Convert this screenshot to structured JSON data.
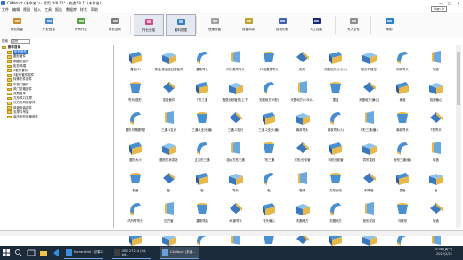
{
  "window": {
    "title": "CAMduct (未命名1) - 套用 \"V8.11\" - 构造 \"8.1\" (未命名)",
    "buttons": [
      "—",
      "□",
      "✕"
    ]
  },
  "menu": [
    "文件",
    "编辑",
    "视图",
    "插入",
    "工具",
    "报告",
    "数据库",
    "样式",
    "帮助"
  ],
  "signin": "Sign In",
  "ribbon": [
    {
      "label": "作业批量",
      "icon": "job-batch-icon",
      "color": "#c98a2a"
    },
    {
      "label": "作业信息",
      "icon": "job-info-icon",
      "color": "#4a8ad0"
    },
    {
      "label": "所有作业",
      "icon": "all-jobs-icon",
      "color": "#5ba04a"
    },
    {
      "label": "作业选项",
      "icon": "job-options-icon",
      "color": "#7a7a7a"
    },
    {
      "label": "作业分组",
      "icon": "job-group-icon",
      "color": "#d04a8a"
    },
    {
      "label": "套料视图",
      "icon": "nesting-view-icon",
      "color": "#3a7ac0"
    },
    {
      "label": "快速设置",
      "icon": "quick-setup-icon",
      "color": "#a0a0a0"
    },
    {
      "label": "设置向导",
      "icon": "setup-wizard-icon",
      "color": "#c0a030"
    },
    {
      "label": "自动切割",
      "icon": "auto-cut-icon",
      "color": "#4060b0"
    },
    {
      "label": "人工加载",
      "icon": "manual-load-icon",
      "color": "#1a2a7a"
    },
    {
      "label": "写入文件",
      "icon": "write-file-icon",
      "color": "#909090"
    },
    {
      "label": "帮助",
      "icon": "help-icon",
      "color": "#3080d0"
    }
  ],
  "filter": {
    "label": "搜索",
    "value": "直线"
  },
  "tree": [
    {
      "label": "部件目录",
      "root": true
    },
    {
      "label": "矩形管件",
      "selected": true
    },
    {
      "label": "圆形管件"
    },
    {
      "label": "椭圆形管件"
    },
    {
      "label": "矩形风帽"
    },
    {
      "label": "2板形管件"
    },
    {
      "label": "3板形管件部件"
    },
    {
      "label": "特殊形件部件"
    },
    {
      "label": "宁夏门管件"
    },
    {
      "label": "风门防烟部件"
    },
    {
      "label": "双层管件"
    },
    {
      "label": "方形风口支撑"
    },
    {
      "label": "长方形风管部件"
    },
    {
      "label": "风管安装部件"
    },
    {
      "label": "支撑与吊架"
    },
    {
      "label": "高压矩形风管部件"
    }
  ],
  "parts": [
    "直管(1)",
    "变径/变截面过渡管件",
    "直角弯头",
    "内外弧弯弯头",
    "45度直角弯头",
    "矩形",
    "天圆地方/小头(L)",
    "矩形内锥形",
    "斜向弯头",
    "铸造",
    "弯头(弧形)",
    "变径管件",
    "T形三通",
    "圆弧分歧管件(上下)",
    "天圆地方(V型)",
    "天圆地方/小头(L)",
    "罩盖",
    "天圆地方(偏心)",
    "铸造",
    "双面偏心",
    "圆形与椭圆T型",
    "三通-1支分",
    "三通-1支分(偏)",
    "三通-2支分",
    "三通-2支分(偏)",
    "裤衩弯头",
    "裤衩弯头(1)",
    "T形三通(偏)",
    "裤衩弯头",
    "T形弯头",
    "圆形大小",
    "圆形形状变化",
    "正方形三通",
    "组合方形三通",
    "T形三通",
    "方形/分支管",
    "斜形分歧管",
    "异形直线",
    "矩形三通(偏)",
    "铸造",
    "斜面",
    "板",
    "板",
    "弯头",
    "板",
    "箱体",
    "方形分歧",
    "斜角管",
    "直管",
    "管",
    "内外弯弯头",
    "四方管",
    "直角弯曲",
    "45度弯头",
    "弯头偏心",
    "天圆地方",
    "天圆地方",
    "矩形变径",
    "马鞍形",
    "铸造",
    "斜角弯头",
    "弯头",
    "直角管",
    "直角弯管",
    "变径管",
    "裤衩管",
    "天方地圆",
    "三通",
    "四通",
    "管"
  ],
  "taskbar": {
    "tasks": [
      {
        "label": "home.html - 记事本"
      },
      {
        "label": "OBS 27.2.4 (64-bit..."
      },
      {
        "label": "CAMduct (未编...",
        "active": true
      }
    ],
    "time": "10:58 (周一)",
    "date": "2022/2/21"
  }
}
